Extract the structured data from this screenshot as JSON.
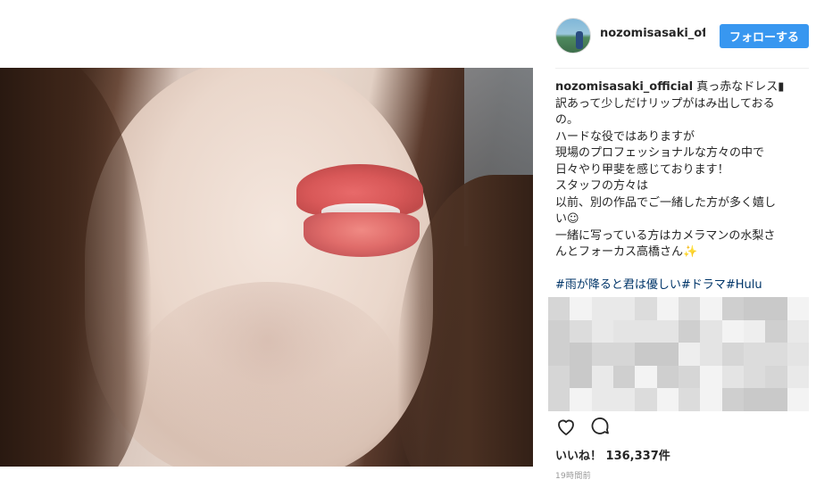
{
  "post": {
    "username": "nozomisasaki_official",
    "follow_label": "フォローする",
    "caption_lines": [
      "真っ赤なドレス▮",
      "訳あって少しだけリップがはみ出しておる",
      "の。",
      "ハードな役ではありますが",
      "現場のプロフェッショナルな方々の中で",
      "日々やり甲斐を感じております！",
      "スタッフの方々は",
      "以前、別の作品でご一緒した方が多く嬉し",
      "い☺",
      "一緒に写っている方はカメラマンの水梨さ",
      "んとフォーカス高橋さん✨"
    ],
    "hashtags": [
      "#雨が降ると君は優しい",
      "#ドラマ",
      "#Hulu"
    ],
    "likes_label": "いいね！",
    "likes_count": "136,337件",
    "time_ago": "19時間前"
  },
  "icons": {
    "like": "heart-outline-icon",
    "comment": "speech-bubble-icon"
  },
  "colors": {
    "follow_button": "#3897f0",
    "hashtag": "#003569",
    "text": "#262626",
    "muted": "#999999"
  }
}
